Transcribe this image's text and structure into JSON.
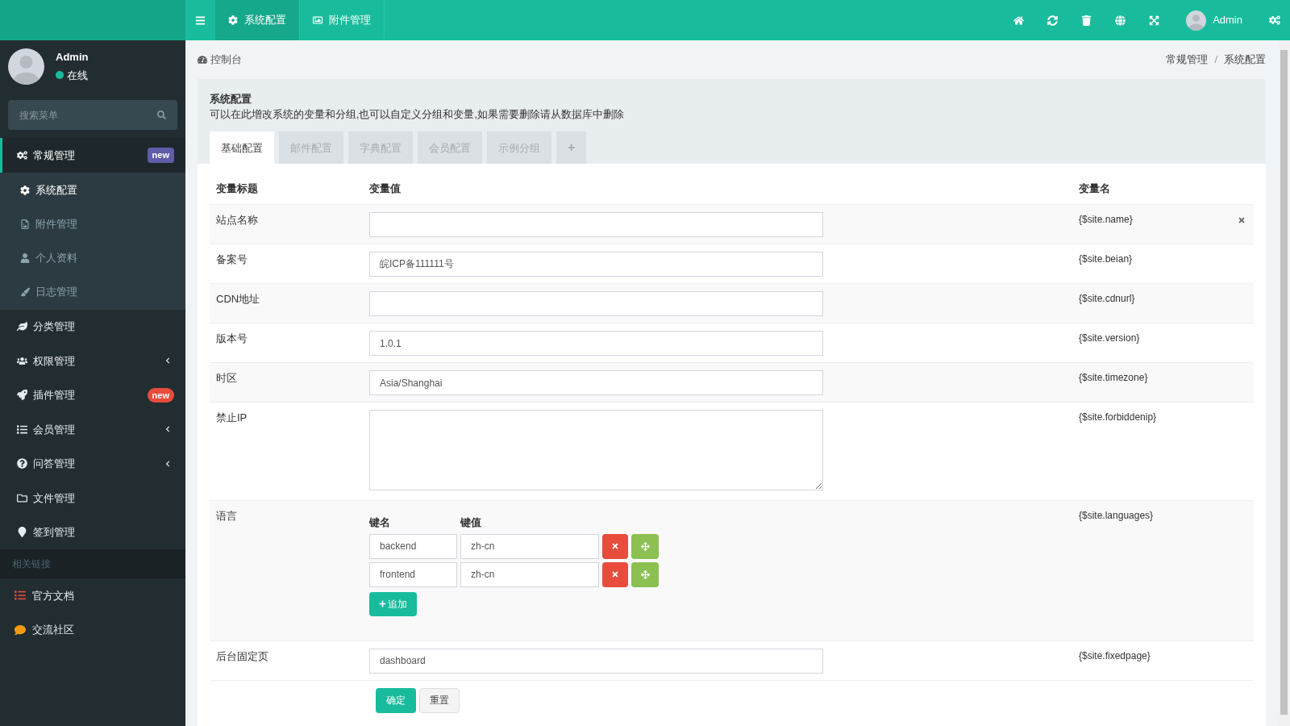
{
  "topbar": {
    "tabs": [
      {
        "label": "系统配置",
        "selected": true
      },
      {
        "label": "附件管理",
        "selected": false
      }
    ],
    "user": "Admin"
  },
  "sidebar": {
    "user": {
      "name": "Admin",
      "status": "在线"
    },
    "search": {
      "placeholder": "搜索菜单"
    },
    "items": [
      {
        "label": "常规管理",
        "selected": true,
        "expanded": true,
        "badge": "new",
        "color": "#605ca8",
        "children": [
          {
            "label": "系统配置",
            "selected": true
          },
          {
            "label": "附件管理",
            "selected": false
          },
          {
            "label": "个人资料",
            "selected": false
          },
          {
            "label": "日志管理",
            "selected": false
          }
        ]
      },
      {
        "label": "分类管理",
        "selected": false
      },
      {
        "label": "权限管理",
        "selected": false,
        "expanded": false,
        "has_submenu": true
      },
      {
        "label": "插件管理",
        "selected": false,
        "badge": "new",
        "color": "#e74c3c"
      },
      {
        "label": "会员管理",
        "selected": false,
        "expanded": false,
        "has_submenu": true
      },
      {
        "label": "问答管理",
        "selected": false,
        "expanded": false,
        "has_submenu": true
      },
      {
        "label": "文件管理",
        "selected": false
      },
      {
        "label": "签到管理",
        "selected": false
      }
    ],
    "links_header": "相关链接",
    "links": [
      {
        "label": "官方文档",
        "color": "#dd4b39"
      },
      {
        "label": "交流社区",
        "color": "#f39c12"
      }
    ]
  },
  "page": {
    "title": "控制台",
    "breadcrumb": [
      "常规管理",
      "系统配置"
    ],
    "breadcrumb_separator": "/"
  },
  "panel": {
    "title": "系统配置",
    "description": "可以在此增改系统的变量和分组,也可以自定义分组和变量,如果需要删除请从数据库中删除",
    "tabs": [
      {
        "label": "基础配置",
        "selected": true
      },
      {
        "label": "邮件配置",
        "selected": false
      },
      {
        "label": "字典配置",
        "selected": false
      },
      {
        "label": "会员配置",
        "selected": false
      },
      {
        "label": "示例分组",
        "selected": false
      }
    ],
    "add_tab": "+",
    "columns": [
      "变量标题",
      "变量值",
      "变量名"
    ],
    "rows": [
      {
        "kind": "text",
        "title": "站点名称",
        "value": "",
        "name": "{$site.name}",
        "hovered": true
      },
      {
        "kind": "text",
        "title": "备案号",
        "value": "皖ICP备111111号",
        "name": "{$site.beian}",
        "hovered": false
      },
      {
        "kind": "text",
        "title": "CDN地址",
        "value": "",
        "name": "{$site.cdnurl}",
        "hovered": false
      },
      {
        "kind": "text",
        "title": "版本号",
        "value": "1.0.1",
        "name": "{$site.version}",
        "hovered": false
      },
      {
        "kind": "text",
        "title": "时区",
        "value": "Asia/Shanghai",
        "name": "{$site.timezone}",
        "hovered": false
      },
      {
        "kind": "textarea",
        "title": "禁止IP",
        "value": "",
        "name": "{$site.forbiddenip}",
        "hovered": false
      },
      {
        "kind": "array",
        "title": "语言",
        "name": "{$site.languages}",
        "hovered": false,
        "key_header": "键名",
        "value_header": "键值",
        "pairs": [
          {
            "key": "backend",
            "value": "zh-cn"
          },
          {
            "key": "frontend",
            "value": "zh-cn"
          }
        ],
        "add_label": "追加"
      },
      {
        "kind": "text",
        "title": "后台固定页",
        "value": "dashboard",
        "name": "{$site.fixedpage}",
        "hovered": false
      }
    ],
    "submit": "确定",
    "reset": "重置"
  }
}
